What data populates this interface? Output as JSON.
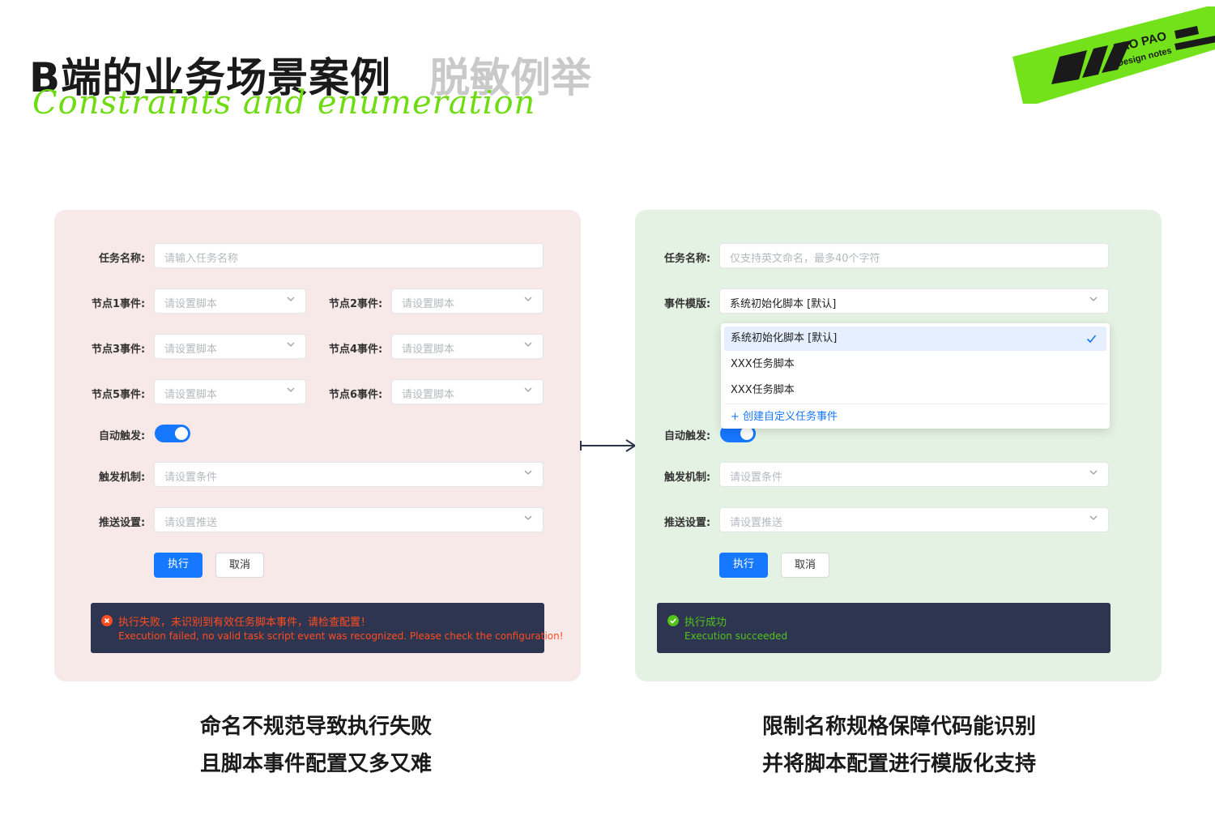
{
  "header": {
    "title_main": "B端的业务场景案例",
    "title_sub": "脱敏例举",
    "title_script": "Constraints and enumeration",
    "logo_line1": "PAO PAO",
    "logo_line2": "Design notes",
    "accent_color": "#6fdc12"
  },
  "left_panel": {
    "background": "#f6e9e7",
    "task_name": {
      "label": "任务名称:",
      "placeholder": "请输入任务名称"
    },
    "node_events": [
      {
        "label": "节点1事件:",
        "placeholder": "请设置脚本"
      },
      {
        "label": "节点2事件:",
        "placeholder": "请设置脚本"
      },
      {
        "label": "节点3事件:",
        "placeholder": "请设置脚本"
      },
      {
        "label": "节点4事件:",
        "placeholder": "请设置脚本"
      },
      {
        "label": "节点5事件:",
        "placeholder": "请设置脚本"
      },
      {
        "label": "节点6事件:",
        "placeholder": "请设置脚本"
      }
    ],
    "auto_trigger": {
      "label": "自动触发:",
      "on": true
    },
    "trigger_mechanism": {
      "label": "触发机制:",
      "placeholder": "请设置条件"
    },
    "push_settings": {
      "label": "推送设置:",
      "placeholder": "请设置推送"
    },
    "buttons": {
      "execute": "执行",
      "cancel": "取消"
    },
    "toast": {
      "status": "error",
      "color": "#ff4d1f",
      "line1": "执行失败，未识别到有效任务脚本事件，请检查配置！",
      "line2": "Execution failed, no valid task script event was recognized. Please check the configuration!"
    }
  },
  "right_panel": {
    "background": "#e4f2e3",
    "task_name": {
      "label": "任务名称:",
      "placeholder": "仅支持英文命名，最多40个字符"
    },
    "event_template": {
      "label": "事件模版:",
      "value": "系统初始化脚本 [默认]"
    },
    "dropdown": {
      "options": [
        "系统初始化脚本 [默认]",
        "XXX任务脚本",
        "XXX任务脚本"
      ],
      "selected_index": 0,
      "create_label": "+ 创建自定义任务事件"
    },
    "auto_trigger": {
      "label": "自动触发:",
      "on": true
    },
    "trigger_mechanism": {
      "label": "触发机制:",
      "placeholder": "请设置条件"
    },
    "push_settings": {
      "label": "推送设置:",
      "placeholder": "请设置推送"
    },
    "buttons": {
      "execute": "执行",
      "cancel": "取消"
    },
    "toast": {
      "status": "success",
      "color": "#52c41a",
      "line1": "执行成功",
      "line2": "Execution succeeded"
    }
  },
  "captions": {
    "left": [
      "命名不规范导致执行失败",
      "且脚本事件配置又多又难"
    ],
    "right": [
      "限制名称规格保障代码能识别",
      "并将脚本配置进行模版化支持"
    ]
  },
  "arrow_icon": "right-arrow-icon",
  "primary_color": "#1677ff"
}
